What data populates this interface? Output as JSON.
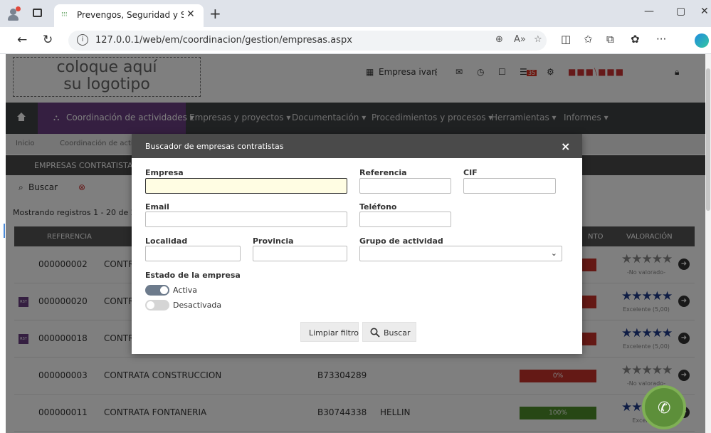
{
  "browser": {
    "tab_title": "Prevengos, Seguridad y Salud Lab",
    "url": "127.0.0.1/web/em/coordinacion/gestion/empresas.aspx",
    "icons": [
      "profile-icon",
      "tab-actions-icon",
      "close-tab-icon",
      "new-tab-icon",
      "minimize-icon",
      "maximize-icon",
      "close-window-icon",
      "back-icon",
      "refresh-icon",
      "info-icon",
      "zoom-icon",
      "read-aloud-icon",
      "favorite-icon",
      "split-screen-icon",
      "favorites-icon",
      "collections-icon",
      "extensions-icon",
      "more-icon",
      "edge-icon"
    ]
  },
  "header": {
    "logo_line1": "coloque aquí",
    "logo_line2": "su logotipo",
    "company": "Empresa ivan",
    "notification_count": "35"
  },
  "menu": {
    "items": [
      {
        "label": "Coordinación de actividades ▾"
      },
      {
        "label": "Empresas y proyectos ▾"
      },
      {
        "label": "Documentación ▾"
      },
      {
        "label": "Procedimientos y procesos ▾"
      },
      {
        "label": "Herramientas ▾"
      },
      {
        "label": "Informes ▾"
      }
    ]
  },
  "breadcrumb": {
    "home": "Inicio",
    "section": "Coordinación de activida"
  },
  "section": {
    "title": "EMPRESAS CONTRATISTAS"
  },
  "toolbar": {
    "search_label": "Buscar"
  },
  "list": {
    "showing": "Mostrando registros 1 - 20 de 20",
    "headers": {
      "referencia": "REFERENCIA",
      "cumplimiento": "NTO",
      "valoracion": "VALORACIÓN"
    },
    "rows": [
      {
        "ref": "000000002",
        "name": "CONTRA",
        "cif": "",
        "city": "",
        "percent": "",
        "stars": "★★★★★",
        "rating": "-No valorado-",
        "bar_color": "#c8322b",
        "rst": false,
        "star_color": "#888"
      },
      {
        "ref": "000000020",
        "name": "CONTRA",
        "cif": "",
        "city": "",
        "percent": "",
        "stars": "★★★★★",
        "rating": "Excelente (5,00)",
        "bar_color": "#c8322b",
        "rst": true,
        "star_color": "#1f3a8a"
      },
      {
        "ref": "000000018",
        "name": "CONTRA",
        "cif": "",
        "city": "",
        "percent": "",
        "stars": "★★★★★",
        "rating": "Excelente (5,00)",
        "bar_color": "#c8322b",
        "rst": true,
        "star_color": "#1f3a8a"
      },
      {
        "ref": "000000003",
        "name": "CONTRATA CONSTRUCCION",
        "cif": "B73304289",
        "city": "",
        "percent": "0%",
        "stars": "★★★★★",
        "rating": "-No valorado-",
        "bar_color": "#c8322b",
        "rst": false,
        "star_color": "#888"
      },
      {
        "ref": "000000011",
        "name": "CONTRATA FONTANERIA",
        "cif": "B30744338",
        "city": "HELLIN",
        "percent": "100%",
        "stars": "★★★",
        "rating": "Excelente",
        "bar_color": "#4f8f2a",
        "rst": false,
        "star_color": "#1f3a8a"
      }
    ],
    "rst_badge": "RST"
  },
  "modal": {
    "title": "Buscador de empresas contratistas",
    "close": "×",
    "fields": {
      "empresa": {
        "label": "Empresa",
        "value": ""
      },
      "referencia": {
        "label": "Referencia",
        "value": ""
      },
      "cif": {
        "label": "CIF",
        "value": ""
      },
      "email": {
        "label": "Email",
        "value": ""
      },
      "telefono": {
        "label": "Teléfono",
        "value": ""
      },
      "localidad": {
        "label": "Localidad",
        "value": ""
      },
      "provincia": {
        "label": "Provincia",
        "value": ""
      },
      "grupo": {
        "label": "Grupo de actividad",
        "value": ""
      }
    },
    "estado": {
      "label": "Estado de la empresa",
      "activa": {
        "label": "Activa",
        "on": true
      },
      "desactivada": {
        "label": "Desactivada",
        "on": false
      }
    },
    "buttons": {
      "clear": "Limpiar filtro",
      "search": "Buscar"
    }
  },
  "colors": {
    "menu_active": "#6a3f83",
    "toggle_on": "#6d7b8c",
    "toggle_off": "#d5d5d5",
    "focus_bg": "#fffde3",
    "call_button": "#5d8f3a"
  }
}
